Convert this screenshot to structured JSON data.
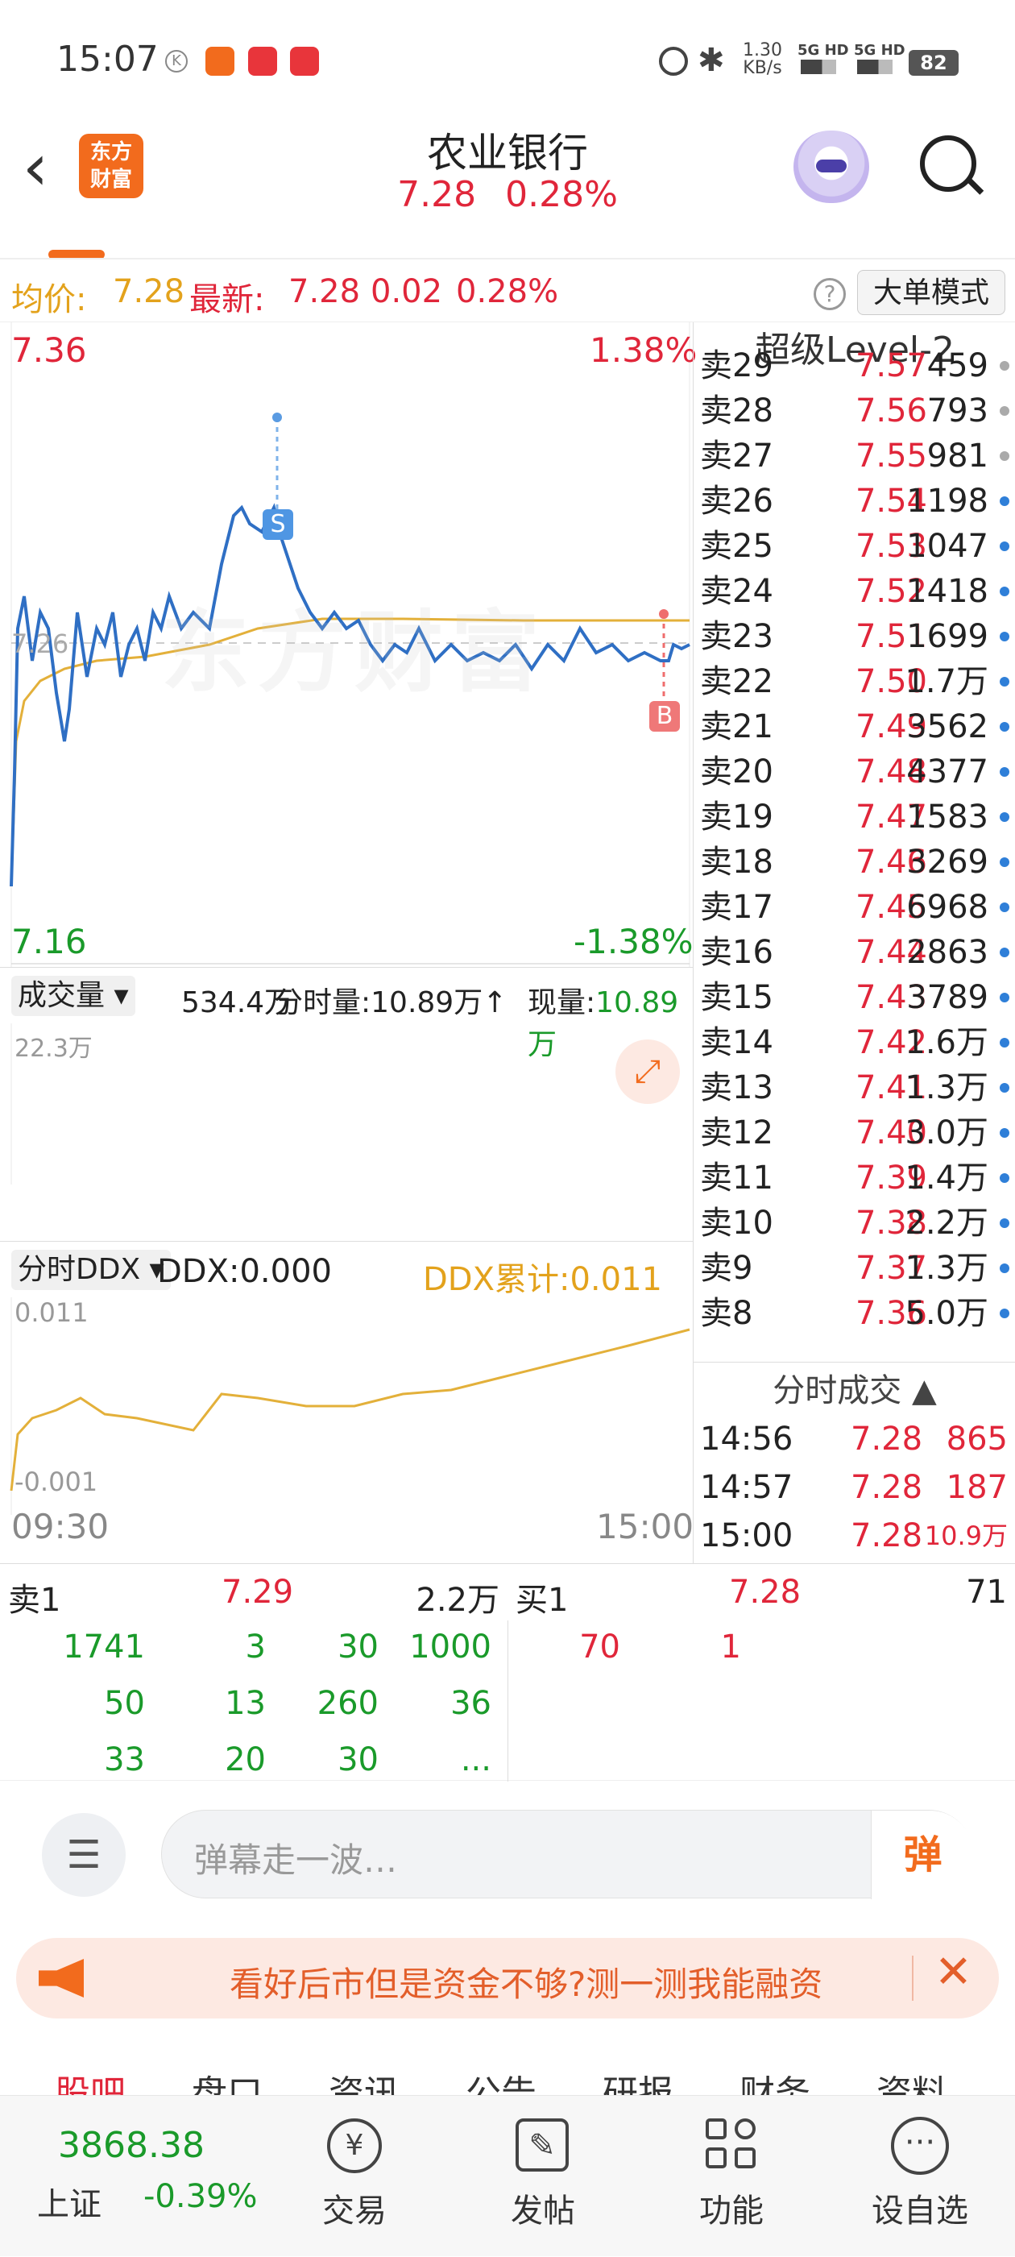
{
  "status_bar": {
    "time": "15:07",
    "net_speed": "1.30",
    "net_unit": "KB/s",
    "sig1": "5G HD",
    "sig2": "5G HD",
    "battery": "82"
  },
  "header": {
    "logo_line1": "东方",
    "logo_line2": "财富",
    "title": "农业银行",
    "price": "7.28",
    "change_pct": "0.28%"
  },
  "price_bar": {
    "avg_label": "均价:",
    "avg_value": "7.28",
    "latest_label": "最新:",
    "latest_value": "7.28",
    "change": "0.02",
    "change_pct": "0.28%",
    "mode_button": "大单模式"
  },
  "chart": {
    "y_top": "7.36",
    "y_top_pct": "1.38%",
    "y_bottom": "7.16",
    "y_bottom_pct": "-1.38%",
    "base_label": "7.26",
    "watermark": "东方财富",
    "sell_marker": "S",
    "buy_marker": "B",
    "volume": {
      "dropdown": "成交量",
      "total": "534.4万",
      "period_label": "分时量:",
      "period_value": "10.89万",
      "arrow": "↑",
      "now_label": "现量:",
      "now_value": "10.89万",
      "max_label": "22.3万"
    },
    "ddx": {
      "dropdown": "分时DDX",
      "ddx_label": "DDX:",
      "ddx_value": "0.000",
      "cum_label": "DDX累计:",
      "cum_value": "0.011",
      "top_label": "0.011",
      "bottom_label": "-0.001"
    },
    "time_start": "09:30",
    "time_end": "15:00"
  },
  "level2": {
    "title": "超级Level-2",
    "asks": [
      {
        "label": "卖29",
        "price": "7.57",
        "vol": "459"
      },
      {
        "label": "卖28",
        "price": "7.56",
        "vol": "793"
      },
      {
        "label": "卖27",
        "price": "7.55",
        "vol": "981"
      },
      {
        "label": "卖26",
        "price": "7.54",
        "vol": "1198"
      },
      {
        "label": "卖25",
        "price": "7.53",
        "vol": "1047"
      },
      {
        "label": "卖24",
        "price": "7.52",
        "vol": "1418"
      },
      {
        "label": "卖23",
        "price": "7.51",
        "vol": "1699"
      },
      {
        "label": "卖22",
        "price": "7.50",
        "vol": "1.7万"
      },
      {
        "label": "卖21",
        "price": "7.49",
        "vol": "3562"
      },
      {
        "label": "卖20",
        "price": "7.48",
        "vol": "4377"
      },
      {
        "label": "卖19",
        "price": "7.47",
        "vol": "1583"
      },
      {
        "label": "卖18",
        "price": "7.46",
        "vol": "3269"
      },
      {
        "label": "卖17",
        "price": "7.45",
        "vol": "6968"
      },
      {
        "label": "卖16",
        "price": "7.44",
        "vol": "2863"
      },
      {
        "label": "卖15",
        "price": "7.43",
        "vol": "3789"
      },
      {
        "label": "卖14",
        "price": "7.42",
        "vol": "1.6万"
      },
      {
        "label": "卖13",
        "price": "7.41",
        "vol": "1.3万"
      },
      {
        "label": "卖12",
        "price": "7.40",
        "vol": "3.0万"
      },
      {
        "label": "卖11",
        "price": "7.39",
        "vol": "1.4万"
      },
      {
        "label": "卖10",
        "price": "7.38",
        "vol": "2.2万"
      },
      {
        "label": "卖9",
        "price": "7.37",
        "vol": "1.3万"
      },
      {
        "label": "卖8",
        "price": "7.36",
        "vol": "5.0万"
      }
    ],
    "trades_title": "分时成交",
    "trades": [
      {
        "time": "14:56",
        "price": "7.28",
        "vol": "865"
      },
      {
        "time": "14:57",
        "price": "7.28",
        "vol": "187"
      },
      {
        "time": "15:00",
        "price": "7.28",
        "vol": "10.9万"
      }
    ]
  },
  "orders": {
    "sell_label": "卖1",
    "sell_price": "7.29",
    "sell_vol": "2.2万",
    "buy_label": "买1",
    "buy_price": "7.28",
    "buy_vol": "71",
    "sell_queue": [
      "1741",
      "3",
      "30",
      "1000",
      "50",
      "13",
      "260",
      "36",
      "33",
      "20",
      "30",
      "..."
    ],
    "buy_queue": [
      "70",
      "1"
    ]
  },
  "danmu": {
    "placeholder": "弹幕走一波…",
    "send": "弹"
  },
  "promo": {
    "text": "看好后市但是资金不够?测一测我能融资"
  },
  "content_tabs": [
    "股吧",
    "盘口",
    "资讯",
    "公告",
    "研报",
    "财务",
    "资料"
  ],
  "bottom_nav": {
    "index_value": "3868.38",
    "index_name": "上证",
    "index_pct": "-0.39%",
    "trade": "交易",
    "post": "发帖",
    "functions": "功能",
    "watchlist": "设自选"
  },
  "colors": {
    "up": "#e0263a",
    "down": "#1a9a2a",
    "line": "#2f6fc4",
    "avg": "#e3b03a",
    "brand": "#f26b1d"
  }
}
